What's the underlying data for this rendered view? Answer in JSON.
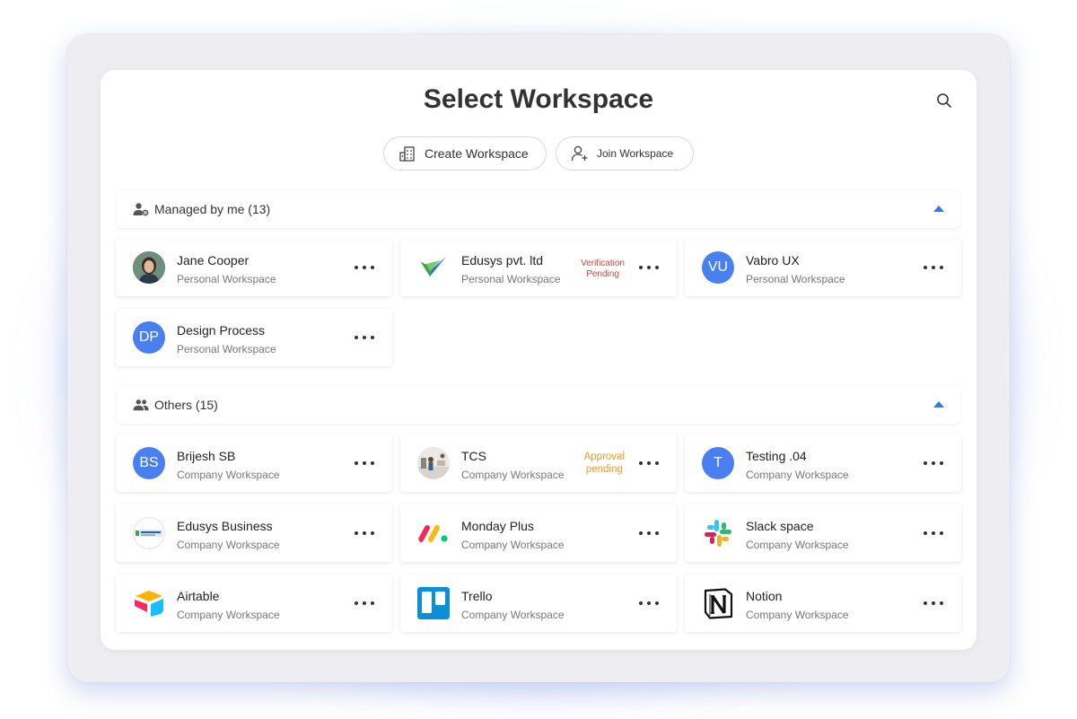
{
  "title": "Select Workspace",
  "actions": {
    "create_label": "Create Workspace",
    "join_label": "Join Workspace"
  },
  "sections": {
    "managed": {
      "label": "Managed by me (13)"
    },
    "others": {
      "label": "Others (15)"
    }
  },
  "managed_cards": [
    {
      "name": "Jane Cooper",
      "sub": "Personal Workspace"
    },
    {
      "name": "Edusys pvt. ltd",
      "sub": "Personal Workspace",
      "status_line1": "Verification",
      "status_line2": "Pending"
    },
    {
      "name": "Vabro UX",
      "sub": "Personal Workspace",
      "initials": "VU"
    },
    {
      "name": "Design Process",
      "sub": "Personal Workspace",
      "initials": "DP"
    }
  ],
  "other_cards": [
    {
      "name": "Brijesh SB",
      "sub": "Company Workspace",
      "initials": "BS"
    },
    {
      "name": "TCS",
      "sub": "Company Workspace",
      "status_line1": "Approval",
      "status_line2": "pending"
    },
    {
      "name": "Testing .04",
      "sub": "Company Workspace",
      "initials": "T"
    },
    {
      "name": "Edusys Business",
      "sub": "Company Workspace"
    },
    {
      "name": "Monday Plus",
      "sub": "Company Workspace"
    },
    {
      "name": "Slack space",
      "sub": "Company Workspace"
    },
    {
      "name": "Airtable",
      "sub": "Company Workspace"
    },
    {
      "name": "Trello",
      "sub": "Company Workspace"
    },
    {
      "name": "Notion",
      "sub": "Company Workspace"
    }
  ],
  "colors": {
    "accent": "#2f7ae5",
    "avatar_bg": "#4a7ff0",
    "pending_red": "#d9453a",
    "pending_orange": "#f0982c"
  }
}
